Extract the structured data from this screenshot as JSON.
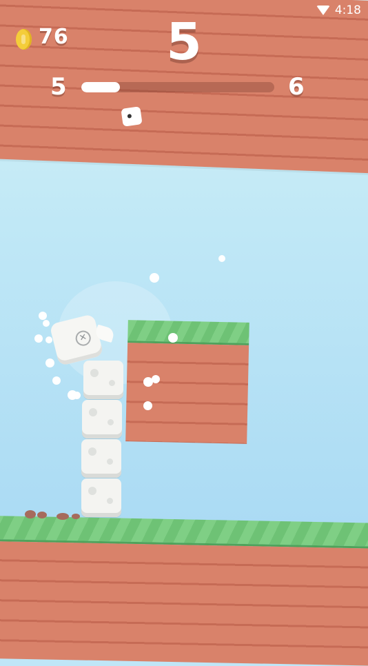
{
  "status_bar": {
    "time": "4:18",
    "icon": "wifi-icon"
  },
  "hud": {
    "coins": "76",
    "coin_icon": "coin-icon",
    "score": "5",
    "level_current": "5",
    "level_next": "6",
    "level_progress": 0.2
  },
  "colors": {
    "grass": "#7fcf85",
    "dirt": "#d9826a",
    "sky": "#bfe6f7",
    "coin": "#f4cd3a"
  },
  "player": {
    "eye_glyph": "✕"
  }
}
